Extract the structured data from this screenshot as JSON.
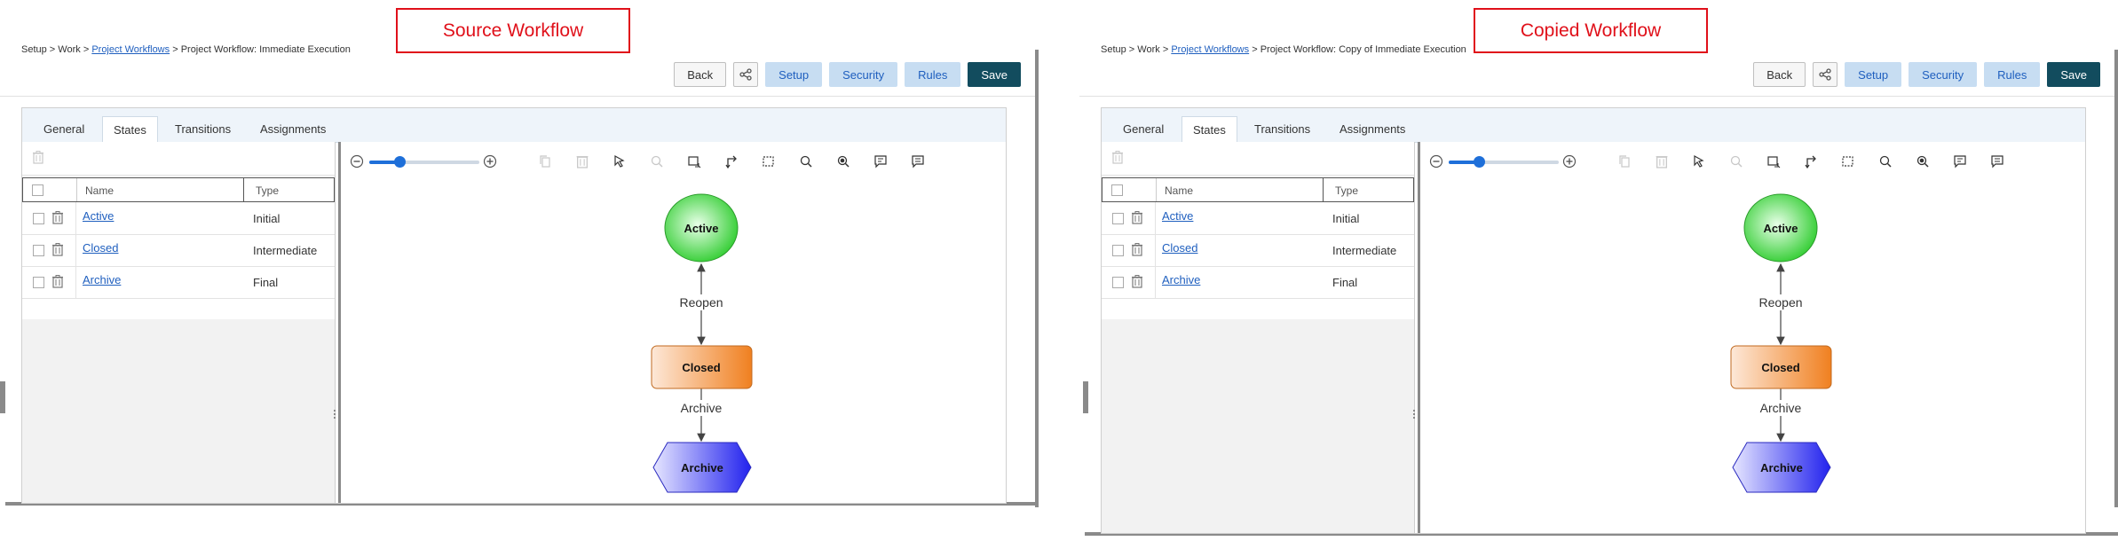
{
  "panes": [
    {
      "callout": "Source Workflow",
      "breadcrumb": {
        "setup": "Setup",
        "sep1": " > ",
        "work": "Work",
        "sep2": " > ",
        "link": "Project Workflows",
        "sep3": " > ",
        "current": "Project Workflow: Immediate Execution"
      },
      "buttons": {
        "back": "Back",
        "setup": "Setup",
        "security": "Security",
        "rules": "Rules",
        "save": "Save"
      },
      "tabs": [
        "General",
        "States",
        "Transitions",
        "Assignments"
      ],
      "active_tab": "States",
      "table": {
        "headers": {
          "name": "Name",
          "type": "Type"
        },
        "rows": [
          {
            "name": "Active",
            "type": "Initial"
          },
          {
            "name": "Closed",
            "type": "Intermediate"
          },
          {
            "name": "Archive",
            "type": "Final"
          }
        ]
      },
      "diagram": {
        "nodes": {
          "active": "Active",
          "closed": "Closed",
          "archive": "Archive"
        },
        "edges": {
          "reopen": "Reopen",
          "archive": "Archive"
        }
      },
      "zoom_fraction": 0.25
    },
    {
      "callout": "Copied Workflow",
      "breadcrumb": {
        "setup": "Setup",
        "sep1": " > ",
        "work": "Work",
        "sep2": " > ",
        "link": "Project Workflows",
        "sep3": " > ",
        "current": "Project Workflow: Copy of Immediate Execution"
      },
      "buttons": {
        "back": "Back",
        "setup": "Setup",
        "security": "Security",
        "rules": "Rules",
        "save": "Save"
      },
      "tabs": [
        "General",
        "States",
        "Transitions",
        "Assignments"
      ],
      "active_tab": "States",
      "table": {
        "headers": {
          "name": "Name",
          "type": "Type"
        },
        "rows": [
          {
            "name": "Active",
            "type": "Initial"
          },
          {
            "name": "Closed",
            "type": "Intermediate"
          },
          {
            "name": "Archive",
            "type": "Final"
          }
        ]
      },
      "diagram": {
        "nodes": {
          "active": "Active",
          "closed": "Closed",
          "archive": "Archive"
        },
        "edges": {
          "reopen": "Reopen",
          "archive": "Archive"
        }
      },
      "zoom_fraction": 0.25
    }
  ],
  "colors": {
    "callout_red": "#e0101a",
    "link_blue": "#1f5fbf",
    "save_button": "#124c5e",
    "light_button": "#c7ddf2",
    "state_initial": "#33cc33",
    "state_intermediate": "#f08a30",
    "state_final": "#3333ee"
  }
}
